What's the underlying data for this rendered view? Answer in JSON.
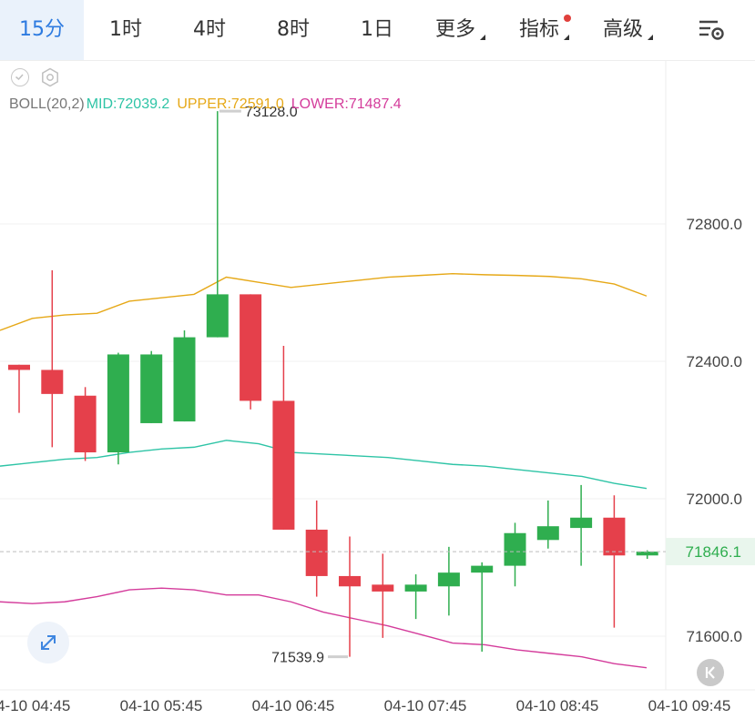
{
  "tabs": [
    {
      "label": "15分",
      "active": true
    },
    {
      "label": "1时",
      "active": false
    },
    {
      "label": "4时",
      "active": false
    },
    {
      "label": "8时",
      "active": false
    },
    {
      "label": "1日",
      "active": false
    },
    {
      "label": "更多",
      "active": false
    },
    {
      "label": "指标",
      "active": false
    },
    {
      "label": "高级",
      "active": false
    }
  ],
  "legend": {
    "name": "BOLL(20,2)",
    "mid": "MID:72039.2",
    "upper": "UPPER:72591.0",
    "lower": "LOWER:71487.4"
  },
  "colors": {
    "accent": "#2d7be0",
    "up": "#2fae4f",
    "down": "#e5404b",
    "mid": "#2ec4a6",
    "upper": "#e6a817",
    "lower": "#d43c9b"
  },
  "icons": [
    "settings-icon",
    "check-circle-icon",
    "gear-icon",
    "expand-icon",
    "jump-to-end-icon"
  ],
  "chart_data": {
    "type": "candlestick",
    "y_ticks": [
      "72800.0",
      "72400.0",
      "72000.0",
      "71600.0"
    ],
    "ylim": [
      71480,
      73150
    ],
    "x_ticks": [
      "04-10 04:45",
      "04-10 05:45",
      "04-10 06:45",
      "04-10 07:45",
      "04-10 08:45",
      "04-10 09:45"
    ],
    "high_label": "73128.0",
    "low_label": "71539.9",
    "last_price": "71846.1",
    "candles": [
      {
        "o": 72390,
        "c": 72375,
        "h": 72390,
        "l": 72250
      },
      {
        "o": 72375,
        "c": 72305,
        "h": 72665,
        "l": 72150
      },
      {
        "o": 72300,
        "c": 72135,
        "h": 72325,
        "l": 72110
      },
      {
        "o": 72135,
        "c": 72420,
        "h": 72425,
        "l": 72100
      },
      {
        "o": 72220,
        "c": 72420,
        "h": 72430,
        "l": 72220
      },
      {
        "o": 72225,
        "c": 72470,
        "h": 72490,
        "l": 72225
      },
      {
        "o": 72470,
        "c": 72595,
        "h": 73128,
        "l": 72470
      },
      {
        "o": 72595,
        "c": 72285,
        "h": 72595,
        "l": 72260
      },
      {
        "o": 72285,
        "c": 71910,
        "h": 72445,
        "l": 71910
      },
      {
        "o": 71910,
        "c": 71775,
        "h": 71995,
        "l": 71715
      },
      {
        "o": 71775,
        "c": 71745,
        "h": 71890,
        "l": 71540
      },
      {
        "o": 71750,
        "c": 71730,
        "h": 71840,
        "l": 71595
      },
      {
        "o": 71730,
        "c": 71750,
        "h": 71780,
        "l": 71650
      },
      {
        "o": 71745,
        "c": 71785,
        "h": 71860,
        "l": 71660
      },
      {
        "o": 71785,
        "c": 71805,
        "h": 71815,
        "l": 71555
      },
      {
        "o": 71805,
        "c": 71900,
        "h": 71930,
        "l": 71745
      },
      {
        "o": 71880,
        "c": 71920,
        "h": 71995,
        "l": 71855
      },
      {
        "o": 71915,
        "c": 71945,
        "h": 72040,
        "l": 71805
      },
      {
        "o": 71945,
        "c": 71835,
        "h": 72010,
        "l": 71625
      },
      {
        "o": 71835,
        "c": 71846.1,
        "h": 71850,
        "l": 71825
      }
    ],
    "series": [
      {
        "name": "UPPER",
        "values": [
          72490,
          72525,
          72535,
          72540,
          72575,
          72585,
          72595,
          72645,
          72630,
          72615,
          72625,
          72635,
          72645,
          72650,
          72655,
          72652,
          72650,
          72647,
          72640,
          72625,
          72590
        ]
      },
      {
        "name": "MID",
        "values": [
          72095,
          72105,
          72115,
          72120,
          72135,
          72145,
          72150,
          72170,
          72160,
          72135,
          72130,
          72125,
          72120,
          72110,
          72100,
          72095,
          72085,
          72075,
          72065,
          72045,
          72030
        ]
      },
      {
        "name": "LOWER",
        "values": [
          71700,
          71695,
          71700,
          71715,
          71735,
          71740,
          71735,
          71720,
          71720,
          71700,
          71670,
          71650,
          71630,
          71605,
          71580,
          71575,
          71560,
          71550,
          71540,
          71520,
          71508
        ]
      }
    ]
  }
}
